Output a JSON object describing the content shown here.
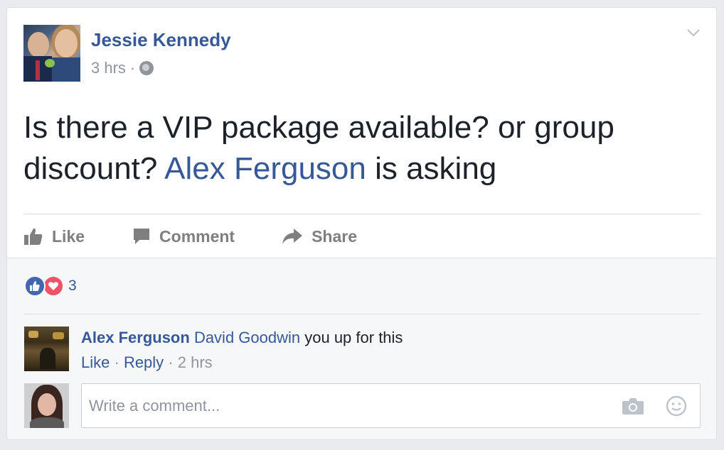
{
  "post": {
    "author": "Jessie Kennedy",
    "time": "3 hrs",
    "separator": "·",
    "privacy_icon": "globe-icon",
    "text_before": "Is there a VIP package available? or group discount? ",
    "mention": "Alex Ferguson",
    "text_after": " is asking"
  },
  "actions": {
    "like": "Like",
    "comment": "Comment",
    "share": "Share"
  },
  "reactions": {
    "types": [
      "like",
      "love"
    ],
    "count": "3"
  },
  "comments": [
    {
      "author": "Alex Ferguson",
      "mention": "David Goodwin",
      "text": " you up for this",
      "like_label": "Like",
      "reply_label": "Reply",
      "separator": "·",
      "time": "2 hrs"
    }
  ],
  "composer": {
    "placeholder": "Write a comment...",
    "value": ""
  },
  "colors": {
    "link": "#365899",
    "meta": "#90949c",
    "like_reaction": "#4267b2",
    "love_reaction": "#f25268"
  }
}
